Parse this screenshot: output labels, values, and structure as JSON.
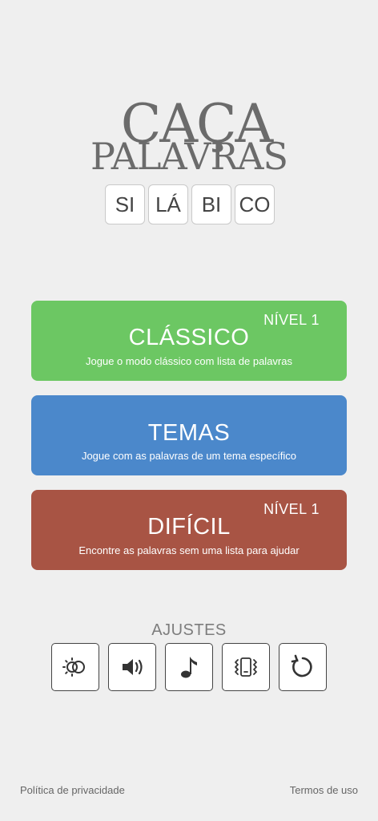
{
  "logo": {
    "line1": "CAÇA",
    "line2": "PALAVRAS",
    "tiles": [
      "SI",
      "LÁ",
      "BI",
      "CO"
    ]
  },
  "modes": [
    {
      "level": "NÍVEL 1",
      "title": "CLÁSSICO",
      "description": "Jogue o modo clássico com lista de palavras",
      "color": "#6cc763"
    },
    {
      "level": "",
      "title": "TEMAS",
      "description": "Jogue com as palavras de um tema específico",
      "color": "#4b88cb"
    },
    {
      "level": "NÍVEL 1",
      "title": "DIFÍCIL",
      "description": "Encontre as palavras sem uma lista para ajudar",
      "color": "#a85444"
    }
  ],
  "settings": {
    "label": "AJUSTES",
    "buttons": [
      "theme-toggle-icon",
      "volume-icon",
      "music-note-icon",
      "vibration-icon",
      "reset-icon"
    ]
  },
  "footer": {
    "privacy": "Política de privacidade",
    "terms": "Termos de uso"
  }
}
